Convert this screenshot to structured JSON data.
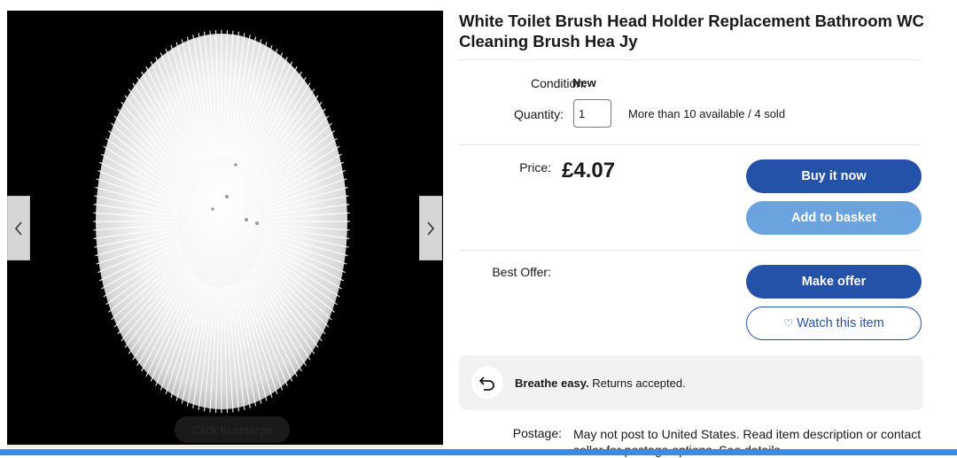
{
  "listing": {
    "title": "White Toilet Brush Head Holder Replacement Bathroom WC Cleaning Brush Hea Jy"
  },
  "gallery": {
    "enlarge_label": "Click to enlarge"
  },
  "details": {
    "condition_label": "Condition:",
    "condition_value": "New",
    "quantity_label": "Quantity:",
    "quantity_value": "1",
    "availability": "More than 10 available / 4 sold"
  },
  "pricing": {
    "price_label": "Price:",
    "price_value": "£4.07",
    "buy_now_label": "Buy it now",
    "add_to_basket_label": "Add to basket"
  },
  "offer": {
    "best_offer_label": "Best Offer:",
    "make_offer_label": "Make offer",
    "watch_label": "Watch this item"
  },
  "returns": {
    "headline": "Breathe easy.",
    "text": "Returns accepted."
  },
  "postage": {
    "label": "Postage:",
    "value": "May not post to United States. Read item description or contact seller for postage options. See details"
  },
  "colors": {
    "primary_button": "#2452a8",
    "secondary_button": "#6aa3dd",
    "returns_bg": "#f2f2f2"
  }
}
